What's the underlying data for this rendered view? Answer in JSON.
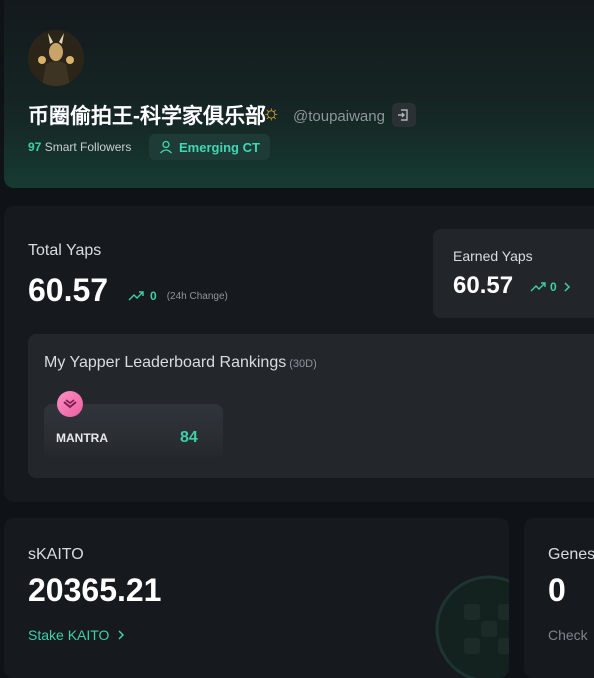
{
  "profile": {
    "name": "币圈偷拍王-科学家俱乐部",
    "name_emoji": "☼",
    "handle": "@toupaiwang",
    "smart_followers_count": "97",
    "smart_followers_label": "Smart Followers",
    "badge_label": "Emerging CT"
  },
  "yaps": {
    "total_label": "Total Yaps",
    "total_value": "60.57",
    "change_value": "0",
    "change_label": "(24h Change)",
    "earned_label": "Earned Yaps",
    "earned_value": "60.57",
    "earned_change": "0"
  },
  "leaderboard": {
    "title": "My Yapper Leaderboard Rankings",
    "period": "(30D)",
    "items": [
      {
        "project": "MANTRA",
        "rank": "84"
      }
    ]
  },
  "skaito": {
    "label": "sKAITO",
    "value": "20365.21",
    "link": "Stake KAITO"
  },
  "genesis": {
    "label": "Genes",
    "value": "0",
    "link": "Check"
  },
  "colors": {
    "accent": "#3fd0a8",
    "background": "#0f1216",
    "card": "#16191d"
  }
}
